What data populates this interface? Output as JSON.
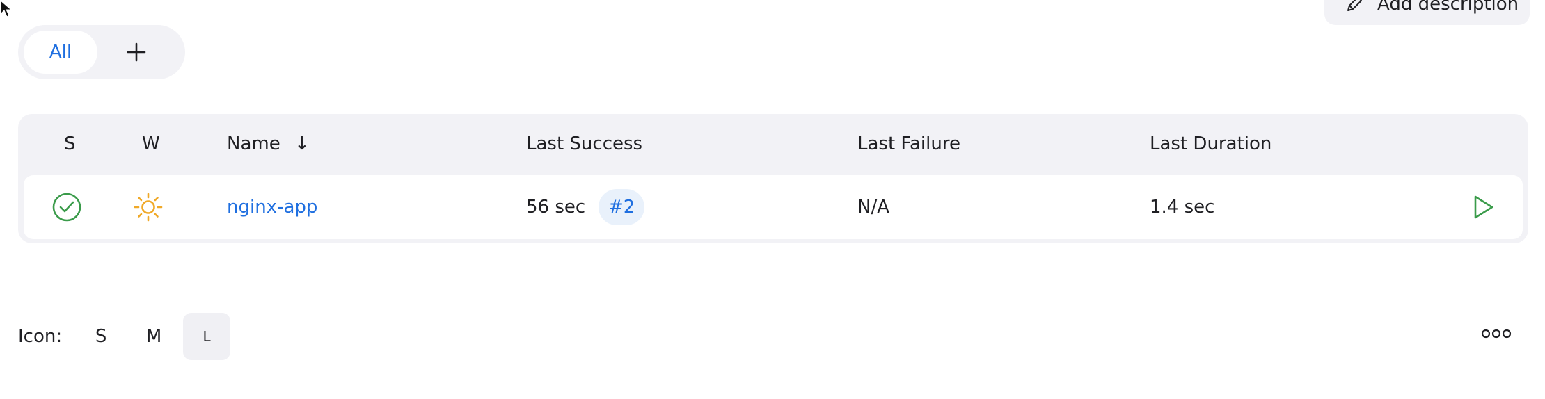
{
  "header": {
    "add_description_label": "Add description"
  },
  "tabs": {
    "active_label": "All",
    "add_symbol": "+"
  },
  "table": {
    "columns": {
      "s": "S",
      "w": "W",
      "name": "Name",
      "sort_arrow": "↓",
      "last_success": "Last Success",
      "last_failure": "Last Failure",
      "last_duration": "Last Duration"
    },
    "rows": [
      {
        "status": "success",
        "weather": "sunny",
        "name": "nginx-app",
        "last_success": "56 sec",
        "build": "#2",
        "last_failure": "N/A",
        "last_duration": "1.4 sec"
      }
    ]
  },
  "icon_size": {
    "label": "Icon:",
    "options": [
      "S",
      "M",
      "L"
    ],
    "selected": "L"
  },
  "colors": {
    "accent": "#1f6fe0",
    "success": "#3a9b4a",
    "sun": "#f0a928",
    "surface": "#f2f2f6"
  },
  "icons": [
    "cursor-icon",
    "pencil-icon",
    "plus-icon",
    "success-check-icon",
    "sun-icon",
    "play-icon",
    "more-icon"
  ]
}
